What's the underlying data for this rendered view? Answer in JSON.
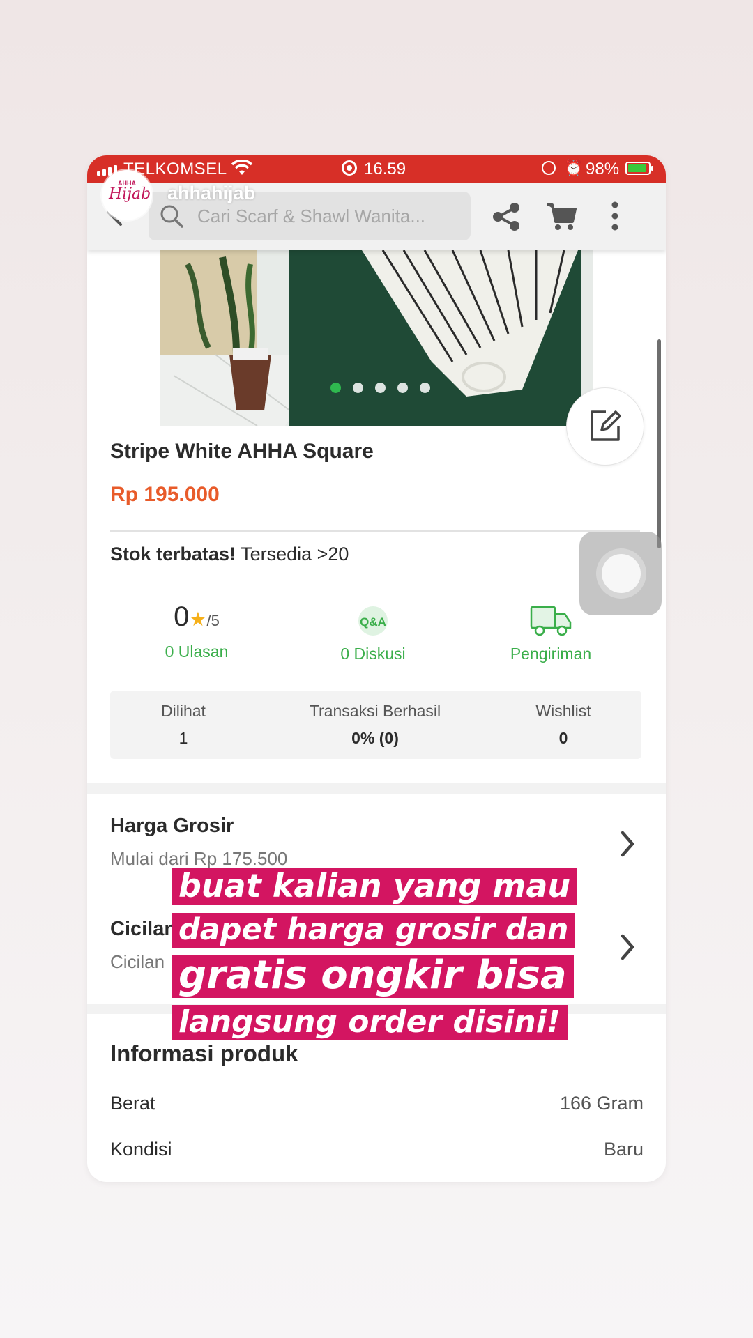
{
  "status_bar": {
    "carrier": "TELKOMSEL",
    "time": "16.59",
    "battery": "98%",
    "bar_color": "#d72f27"
  },
  "story": {
    "username": "ahhahijab",
    "avatar_text": "AHHA Hijab",
    "caption": [
      "buat kalian yang mau",
      "dapet harga grosir dan",
      "gratis ongkir bisa",
      "langsung order disini!"
    ],
    "caption_bg": "#d31561"
  },
  "header": {
    "search_placeholder": "Cari  Scarf & Shawl Wanita...",
    "icons": [
      "back-arrow-icon",
      "search-icon",
      "share-icon",
      "cart-icon",
      "more-vertical-icon"
    ]
  },
  "carousel": {
    "count": 5,
    "active_index": 0,
    "active_color": "#2fb84f"
  },
  "product": {
    "title": "Stripe White AHHA Square",
    "price": "Rp 195.000",
    "price_color": "#e85b2a",
    "stock_bold": "Stok terbatas!",
    "stock_text": "Tersedia >20"
  },
  "stats": {
    "rating": "0",
    "rating_scale": "/5",
    "reviews": "0 Ulasan",
    "discussions": "0 Diskusi",
    "qa_icon_text": "Q&A",
    "shipping": "Pengiriman",
    "link_color": "#3aae4a",
    "viewed_label": "Dilihat",
    "viewed_value": "1",
    "transactions_label": "Transaksi Berhasil",
    "transactions_value": "0% (0)",
    "wishlist_label": "Wishlist",
    "wishlist_value": "0"
  },
  "wholesale": {
    "title": "Harga Grosir",
    "subtitle": "Mulai dari Rp 175.500"
  },
  "installment": {
    "title": "Cicilan",
    "subtitle": "Cicilan"
  },
  "info": {
    "title": "Informasi produk",
    "rows": [
      {
        "label": "Berat",
        "value": "166 Gram"
      },
      {
        "label": "Kondisi",
        "value": "Baru"
      }
    ]
  }
}
